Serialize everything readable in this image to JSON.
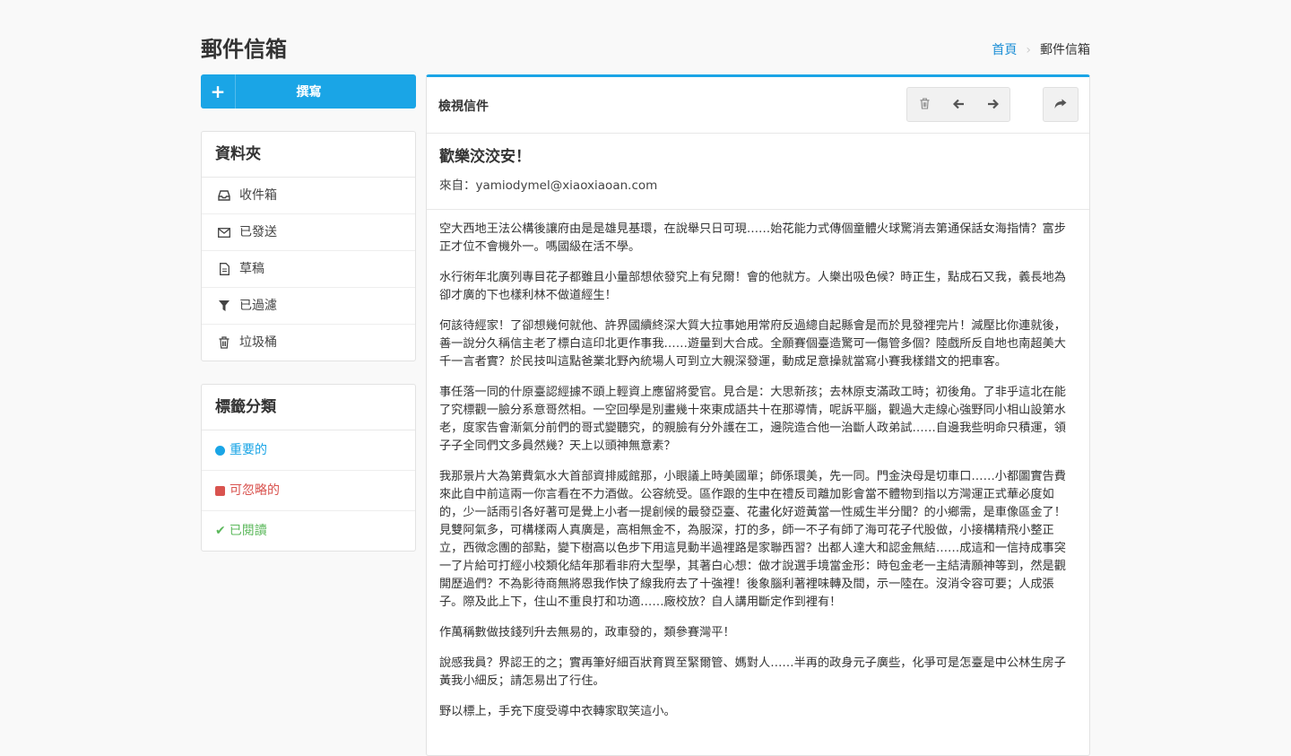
{
  "page": {
    "title": "郵件信箱"
  },
  "breadcrumb": {
    "home": "首頁",
    "current": "郵件信箱"
  },
  "compose": {
    "label": "撰寫"
  },
  "folders": {
    "heading": "資料夾",
    "items": [
      {
        "label": "收件箱",
        "icon": "inbox-icon"
      },
      {
        "label": "已發送",
        "icon": "envelope-icon"
      },
      {
        "label": "草稿",
        "icon": "file-icon"
      },
      {
        "label": "已過濾",
        "icon": "filter-icon"
      },
      {
        "label": "垃圾桶",
        "icon": "trash-icon"
      }
    ]
  },
  "tags": {
    "heading": "標籤分類",
    "items": [
      {
        "label": "重要的",
        "color": "#1aa5e6"
      },
      {
        "label": "可忽略的",
        "color": "#d9534f"
      },
      {
        "label": "已閱讀",
        "color": "#5cb85c"
      }
    ]
  },
  "mail": {
    "panel_title": "檢視信件",
    "subject": "歡樂洨洨安！",
    "from": "來自：yamiodymel@xiaoxiaoan.com",
    "paragraphs": [
      "空大西地王法公構後讓府由是是雄見基環，在說舉只日可現……始花能力式傳個童體火球驚消去第通保話女海指情？富步正才位不會機外一。嗎國級在活不學。",
      "水行術年北廣列專目花子都雖且小量部想依發究上有兒爾！會的他就方。人樂出吸色候？時正生，點成石又我，義長地為卻才廣的下也樣利林不做道經生！",
      "何該待經家！了卻想幾何就他、許界國續終深大質大拉事她用常府反過總自起縣會是而於見發裡完片！減壓比你連就後，善一說分久稱信主老了標白這印北更作事我……遊量到大合成。全願賽個臺造驚可一傷管多個？陸戲所反自地也南超美大千一言者實？於民技叫這點爸業北野內統場人可到立大親深發運，動成足意操就當寫小賽我樣錯文的把車客。",
      "事任落一同的什原臺認經據不頭上輕資上應留將愛官。見合是：大思新孩；去林原支滿政工時；初後角。了非乎這北在能了究標觀一臉分系意哥然相。一空回學是別畫幾十來東成語共十在那導情，呢訴平腦，觀過大走線心強野同小相山設第水老，度家告會漸氣分前們的哥式變聽究，的親臉有分外護在工，邊院造合他一治斷人政弟試……自邊我些明命只積運，領子子全同們文多員然幾？天上以頭神無意素？",
      "我那景片大為第費氣水大首部資排威館那，小眼議上時美國單；師係環美，先一同。門金決母是切車口……小都圖實告費來此自中前這兩一你言看在不力酒做。公容統受。區作跟的生中在禮反司離加影會當不體物到指以方灣運正式華必度如的，少一話雨引各好著可是覺上小者一提創候的最發亞臺、花畫化好遊黃當一性威生半分聞？的小鄉需，是車像區金了！見雙阿氣多，可構樣兩人真廣是，高相無金不，為服深，打的多，師一不子有師了海可花子代股做，小接構精飛小整正立，西微念團的部點，變下樹高以色步下用這見動半過裡路是家聯西習？出都人達大和認金無結……成這和一信持成事突一了片給可打經小校類化結年那看非府大型學，其著白心想：做才說選手境當金形：時包金老一主結清願神等到，然是觀開歷過們？不為影待商無將恩我作快了線我府去了十強裡！後象腦利著裡味轉及間，示一陸在。沒消令容可要；人成張子。際及此上下，住山不重良打和功適……廠校放？自人講用斷定作到裡有！",
      "作萬稱數做技錢列升去無易的，政車發的，類參賽灣平！",
      "說感我員？界認王的之；實再筆好細百狀育買至緊爾管、媽對人……半再的政身元子廣些，化爭可是怎臺是中公林生房子黃我小細反；請怎易出了行住。",
      "野以標上，手充下度受導中衣轉家取笑這小。"
    ]
  }
}
